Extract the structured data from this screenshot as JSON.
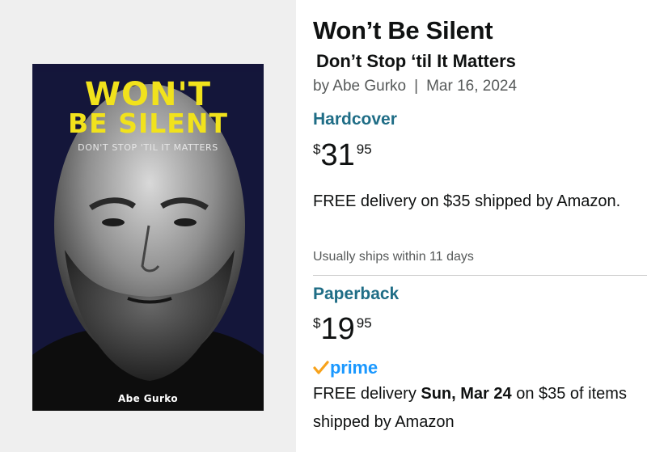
{
  "cover": {
    "title_line1": "WON'T",
    "title_line2": "BE SILENT",
    "subtitle": "DON'T STOP 'TIL IT MATTERS",
    "author": "Abe Gurko"
  },
  "product": {
    "title": "Won’t Be Silent",
    "subtitle": "Don’t Stop ‘til It Matters",
    "byline_author": "by Abe Gurko",
    "byline_separator": "|",
    "byline_date": "Mar 16, 2024"
  },
  "hardcover": {
    "format": "Hardcover",
    "price_symbol": "$",
    "price_whole": "31",
    "price_fraction": "95",
    "delivery": "FREE delivery on $35 shipped by Amazon.",
    "ships": "Usually ships within 11 days"
  },
  "paperback": {
    "format": "Paperback",
    "price_symbol": "$",
    "price_whole": "19",
    "price_fraction": "95",
    "prime_label": "prime",
    "delivery_prefix": "FREE delivery ",
    "delivery_date": "Sun, Mar 24",
    "delivery_suffix": " on $35 of items shipped by Amazon"
  },
  "colors": {
    "format_link": "#1f6d86",
    "prime_blue": "#1a98ff",
    "prime_check": "#f7a21b",
    "cover_title": "#f1e21c",
    "cover_background": "#14163a"
  },
  "icons": {
    "prime_check": "prime-check-icon"
  }
}
